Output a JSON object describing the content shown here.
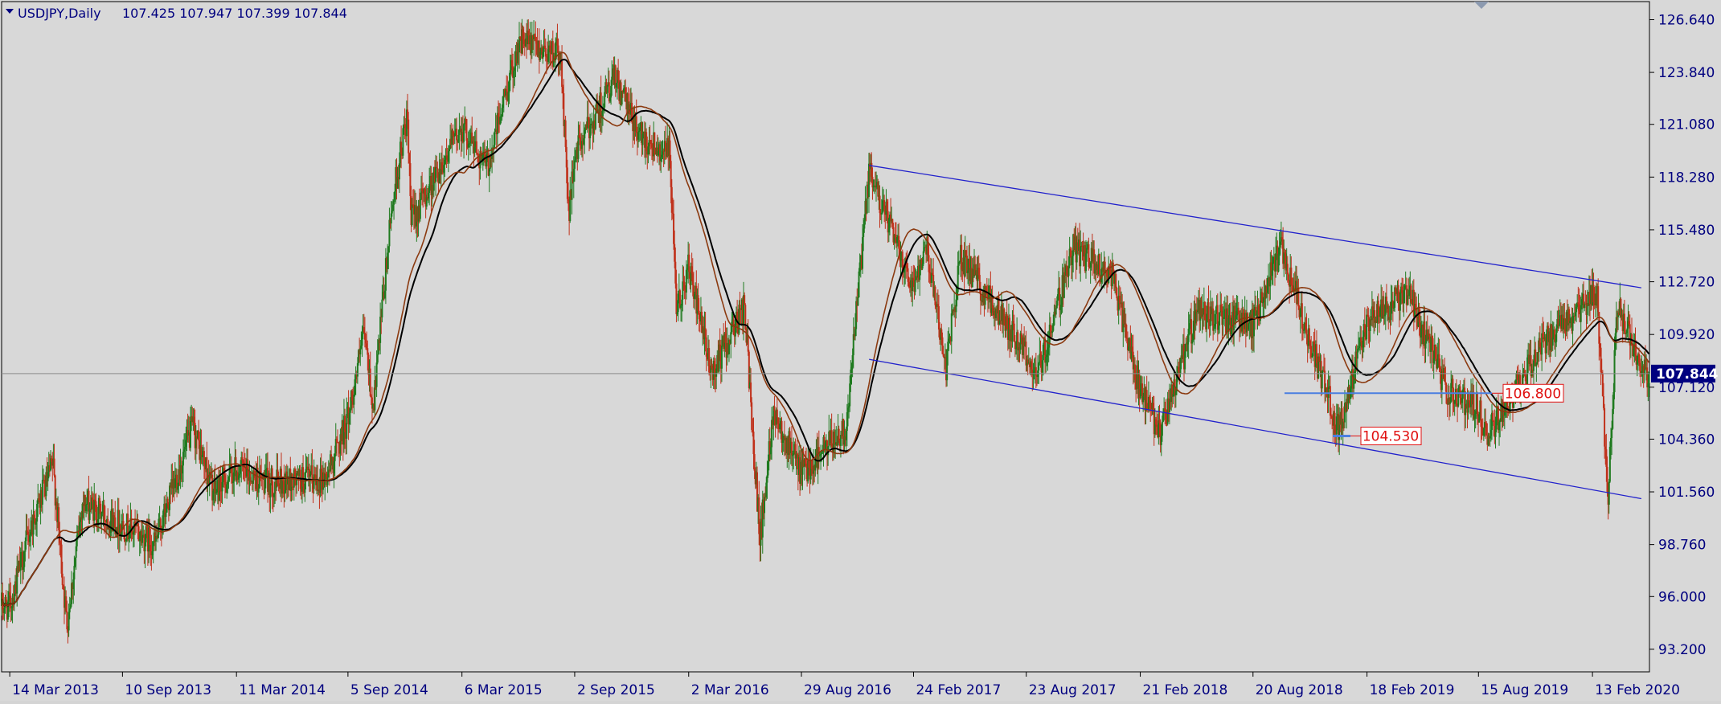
{
  "header": {
    "symbol": "USDJPY,Daily",
    "ohlc": "107.425 107.947 107.399 107.844"
  },
  "colors": {
    "background": "#d8d8d8",
    "frame": "#000000",
    "axis_text": "#00007f",
    "bull_candle": "#1f7a1f",
    "bear_candle": "#c0301a",
    "ma_fast": "#8b3a10",
    "ma_slow": "#000000",
    "channel": "#2222cc",
    "support": "#4a7fe0",
    "price_label_bg": "#00007f",
    "level_label_border": "#e01010",
    "level_label_text": "#e01010"
  },
  "chart_data": {
    "type": "candlestick",
    "title": "USDJPY,Daily",
    "y_axis": {
      "min": 92.0,
      "max": 127.6,
      "ticks": [
        "126.640",
        "123.840",
        "121.080",
        "118.280",
        "115.480",
        "112.720",
        "109.920",
        "107.120",
        "104.360",
        "101.560",
        "98.760",
        "96.000",
        "93.200"
      ]
    },
    "x_axis": {
      "ticks": [
        "14 Mar 2013",
        "10 Sep 2013",
        "11 Mar 2014",
        "5 Sep 2014",
        "6 Mar 2015",
        "2 Sep 2015",
        "2 Mar 2016",
        "29 Aug 2016",
        "24 Feb 2017",
        "23 Aug 2017",
        "21 Feb 2018",
        "20 Aug 2018",
        "18 Feb 2019",
        "15 Aug 2019",
        "13 Feb 2020"
      ]
    },
    "price_path": [
      [
        "14 Mar 2013",
        95.5
      ],
      [
        "15 Apr 2013",
        99.5
      ],
      [
        "22 May 2013",
        103.0
      ],
      [
        "13 Jun 2013",
        94.5
      ],
      [
        "8 Jul 2013",
        101.0
      ],
      [
        "10 Sep 2013",
        99.8
      ],
      [
        "1 Nov 2013",
        98.8
      ],
      [
        "31 Dec 2013",
        105.0
      ],
      [
        "3 Feb 2014",
        101.5
      ],
      [
        "11 Mar 2014",
        102.8
      ],
      [
        "1 May 2014",
        102.0
      ],
      [
        "1 Aug 2014",
        102.3
      ],
      [
        "5 Sep 2014",
        105.5
      ],
      [
        "1 Oct 2014",
        110.0
      ],
      [
        "15 Oct 2014",
        106.0
      ],
      [
        "15 Nov 2014",
        117.0
      ],
      [
        "8 Dec 2014",
        121.5
      ],
      [
        "15 Dec 2014",
        116.0
      ],
      [
        "6 Mar 2015",
        121.0
      ],
      [
        "15 Apr 2015",
        118.8
      ],
      [
        "5 Jun 2015",
        125.5
      ],
      [
        "10 Aug 2015",
        124.8
      ],
      [
        "24 Aug 2015",
        116.2
      ],
      [
        "2 Sep 2015",
        119.5
      ],
      [
        "5 Nov 2015",
        123.5
      ],
      [
        "15 Dec 2015",
        120.5
      ],
      [
        "1 Feb 2016",
        119.5
      ],
      [
        "11 Feb 2016",
        111.0
      ],
      [
        "2 Mar 2016",
        113.5
      ],
      [
        "7 Apr 2016",
        107.8
      ],
      [
        "30 May 2016",
        111.4
      ],
      [
        "24 Jun 2016",
        99.0
      ],
      [
        "15 Jul 2016",
        106.0
      ],
      [
        "29 Aug 2016",
        102.5
      ],
      [
        "8 Nov 2016",
        105.0
      ],
      [
        "15 Dec 2016",
        118.5
      ],
      [
        "24 Feb 2017",
        112.5
      ],
      [
        "15 Mar 2017",
        115.0
      ],
      [
        "17 Apr 2017",
        108.2
      ],
      [
        "10 May 2017",
        114.0
      ],
      [
        "23 Aug 2017",
        109.0
      ],
      [
        "8 Sep 2017",
        107.5
      ],
      [
        "6 Nov 2017",
        114.5
      ],
      [
        "8 Jan 2018",
        113.0
      ],
      [
        "21 Feb 2018",
        106.8
      ],
      [
        "26 Mar 2018",
        104.7
      ],
      [
        "21 May 2018",
        111.0
      ],
      [
        "20 Aug 2018",
        110.5
      ],
      [
        "4 Oct 2018",
        114.5
      ],
      [
        "3 Jan 2019",
        104.9
      ],
      [
        "18 Feb 2019",
        110.5
      ],
      [
        "24 Apr 2019",
        112.2
      ],
      [
        "25 Jun 2019",
        107.0
      ],
      [
        "26 Aug 2019",
        104.5
      ],
      [
        "15 Aug 2019",
        106.0
      ],
      [
        "30 Nov 2019",
        109.5
      ],
      [
        "20 Feb 2020",
        112.2
      ],
      [
        "9 Mar 2020",
        101.2
      ],
      [
        "24 Mar 2020",
        111.7
      ],
      [
        "30 Apr 2020",
        107.8
      ]
    ],
    "moving_averages": [
      {
        "name": "MA fast",
        "color": "#8b3a10"
      },
      {
        "name": "MA slow",
        "color": "#000000"
      }
    ],
    "channel": {
      "upper": [
        [
          "15 Dec 2016",
          118.9
        ],
        [
          "1 May 2020",
          112.4
        ]
      ],
      "lower": [
        [
          "15 Dec 2016",
          108.6
        ],
        [
          "1 May 2020",
          101.2
        ]
      ]
    },
    "levels": [
      {
        "value": 106.8,
        "label": "106.800"
      },
      {
        "value": 104.53,
        "label": "104.530"
      }
    ],
    "current_price": 107.844,
    "current_price_label": "107.844",
    "grid": false
  }
}
